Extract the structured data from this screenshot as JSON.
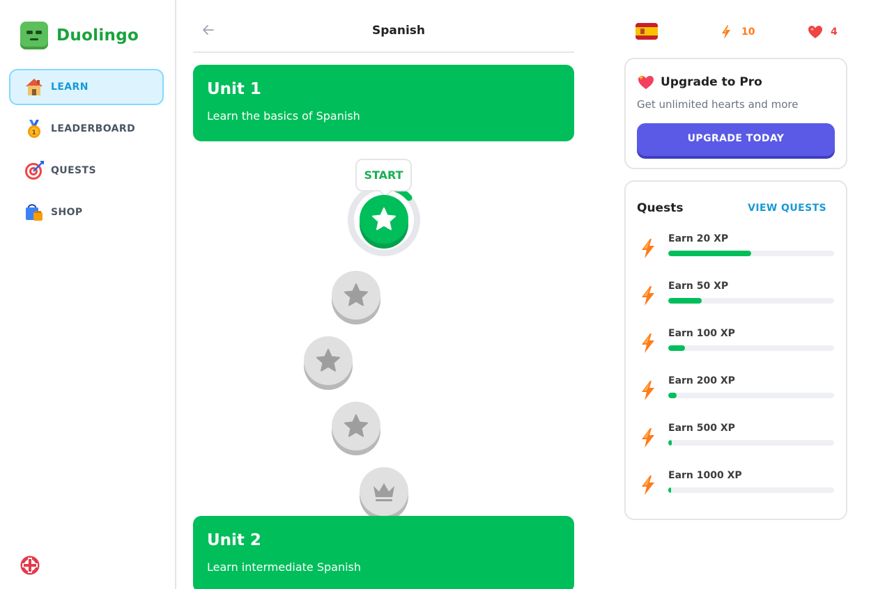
{
  "app": {
    "name": "Duolingo"
  },
  "sidebar": {
    "items": [
      {
        "label": "LEARN",
        "icon": "house-icon",
        "active": true
      },
      {
        "label": "LEADERBOARD",
        "icon": "medal-icon",
        "active": false
      },
      {
        "label": "QUESTS",
        "icon": "target-icon",
        "active": false
      },
      {
        "label": "SHOP",
        "icon": "shopping-bag-icon",
        "active": false
      }
    ],
    "footer_icon": "support-icon"
  },
  "header": {
    "course_title": "Spanish",
    "back_icon": "arrow-left-icon"
  },
  "units": [
    {
      "title": "Unit 1",
      "description": "Learn the basics of Spanish"
    },
    {
      "title": "Unit 2",
      "description": "Learn intermediate Spanish"
    }
  ],
  "path": {
    "start_label": "START",
    "lessons": [
      {
        "state": "active",
        "icon": "star-icon"
      },
      {
        "state": "locked",
        "icon": "star-icon"
      },
      {
        "state": "locked",
        "icon": "star-icon"
      },
      {
        "state": "locked",
        "icon": "star-icon"
      },
      {
        "state": "locked",
        "icon": "crown-icon"
      }
    ]
  },
  "stats": {
    "language_flag": "spain-flag-icon",
    "streak": "10",
    "hearts": "4"
  },
  "pro": {
    "title": "Upgrade to Pro",
    "subtitle": "Get unlimited hearts and more",
    "button_label": "UPGRADE TODAY"
  },
  "quests": {
    "title": "Quests",
    "view_label": "VIEW QUESTS",
    "items": [
      {
        "label": "Earn 20 XP",
        "progress": 0.5
      },
      {
        "label": "Earn 50 XP",
        "progress": 0.2
      },
      {
        "label": "Earn 100 XP",
        "progress": 0.1
      },
      {
        "label": "Earn 200 XP",
        "progress": 0.05
      },
      {
        "label": "Earn 500 XP",
        "progress": 0.02
      },
      {
        "label": "Earn 1000 XP",
        "progress": 0.01
      }
    ]
  },
  "colors": {
    "brand_green": "#00be5a",
    "active_blue": "#1899d6",
    "pro_purple": "#5a5ae6",
    "streak_orange": "#ff7a1a",
    "heart_red": "#ef4444",
    "locked_gray": "#e0e0e0"
  }
}
